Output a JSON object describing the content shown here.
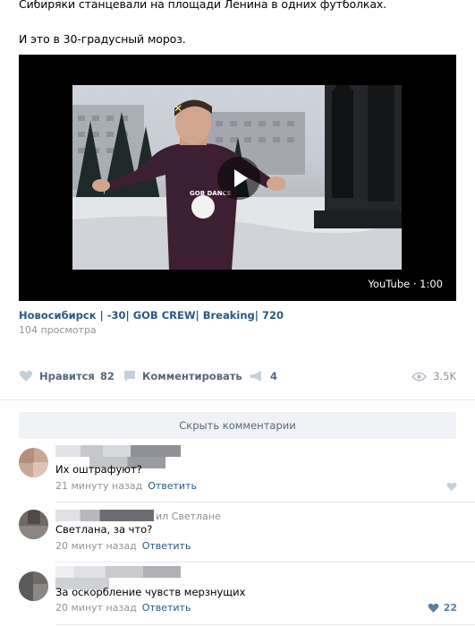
{
  "post": {
    "line1": "Сибиряки станцевали на площади Ленина в одних футболках.",
    "line2": "И это в 30-градусный мороз."
  },
  "video": {
    "source": "YouTube",
    "duration": "1:00",
    "meta": "YouTube · 1:00",
    "shirt_text": "GOB DANCE",
    "title": "Новосибирск | -30| GOB CREW| Breaking| 720",
    "views": "104 просмотра"
  },
  "actions": {
    "like_label": "Нравится",
    "like_count": "82",
    "comment_label": "Комментировать",
    "share_count": "4",
    "views_count": "3.5K"
  },
  "comments_toggle": "Скрыть комментарии",
  "comments": [
    {
      "author": "",
      "text": "Их оштрафуют?",
      "time": "21 минуту назад",
      "reply": "Ответить",
      "likes": ""
    },
    {
      "author": "",
      "reply_to": "ил Светлане",
      "text": "Светлана, за что?",
      "time": "20 минут назад",
      "reply": "Ответить",
      "likes": ""
    },
    {
      "author": "",
      "text": "За оскорбление чувств мерзнущих",
      "time": "20 минут назад",
      "reply": "Ответить",
      "likes": "22"
    }
  ],
  "colors": {
    "link": "#2a5885",
    "muted": "#939393",
    "action": "#55677d",
    "like_icon": "#c5d0db"
  },
  "icons": [
    "play-icon",
    "heart-icon",
    "comment-icon",
    "share-icon",
    "eye-icon"
  ]
}
